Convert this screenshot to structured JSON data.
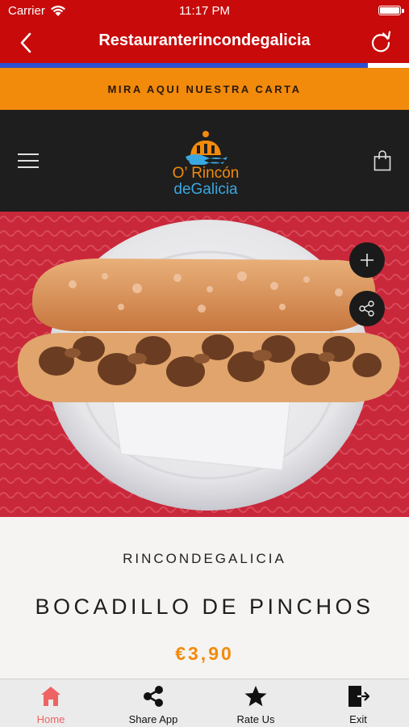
{
  "status_bar": {
    "carrier": "Carrier",
    "time": "11:17 PM"
  },
  "nav": {
    "title": "Restauranterincondegalicia",
    "back_icon": "chevron-left-icon",
    "refresh_icon": "refresh-icon"
  },
  "page_load_progress": 0.9,
  "banner": {
    "text": "MIRA AQUI NUESTRA CARTA"
  },
  "header": {
    "logo_line1": "O’ Rincón",
    "logo_line2": "deGalicia",
    "menu_icon": "hamburger-menu-icon",
    "cart_icon": "shopping-bag-icon"
  },
  "product": {
    "vendor": "RINCONDEGALICIA",
    "title": "BOCADILLO DE PINCHOS",
    "price": "€3,90"
  },
  "floating_buttons": {
    "add_icon": "plus-icon",
    "share_icon": "share-icon"
  },
  "tab_bar": {
    "items": [
      {
        "label": "Home",
        "icon": "home-icon",
        "active": true
      },
      {
        "label": "Share App",
        "icon": "share-nodes-icon",
        "active": false
      },
      {
        "label": "Rate Us",
        "icon": "star-icon",
        "active": false
      },
      {
        "label": "Exit",
        "icon": "exit-icon",
        "active": false
      }
    ]
  },
  "colors": {
    "nav_red": "#c80a0a",
    "banner_orange": "#f28a0c",
    "header_dark": "#1e1e1e",
    "price_orange": "#f28a0c",
    "active_tab": "#ee6363",
    "progress_blue": "#2e4fd0"
  }
}
